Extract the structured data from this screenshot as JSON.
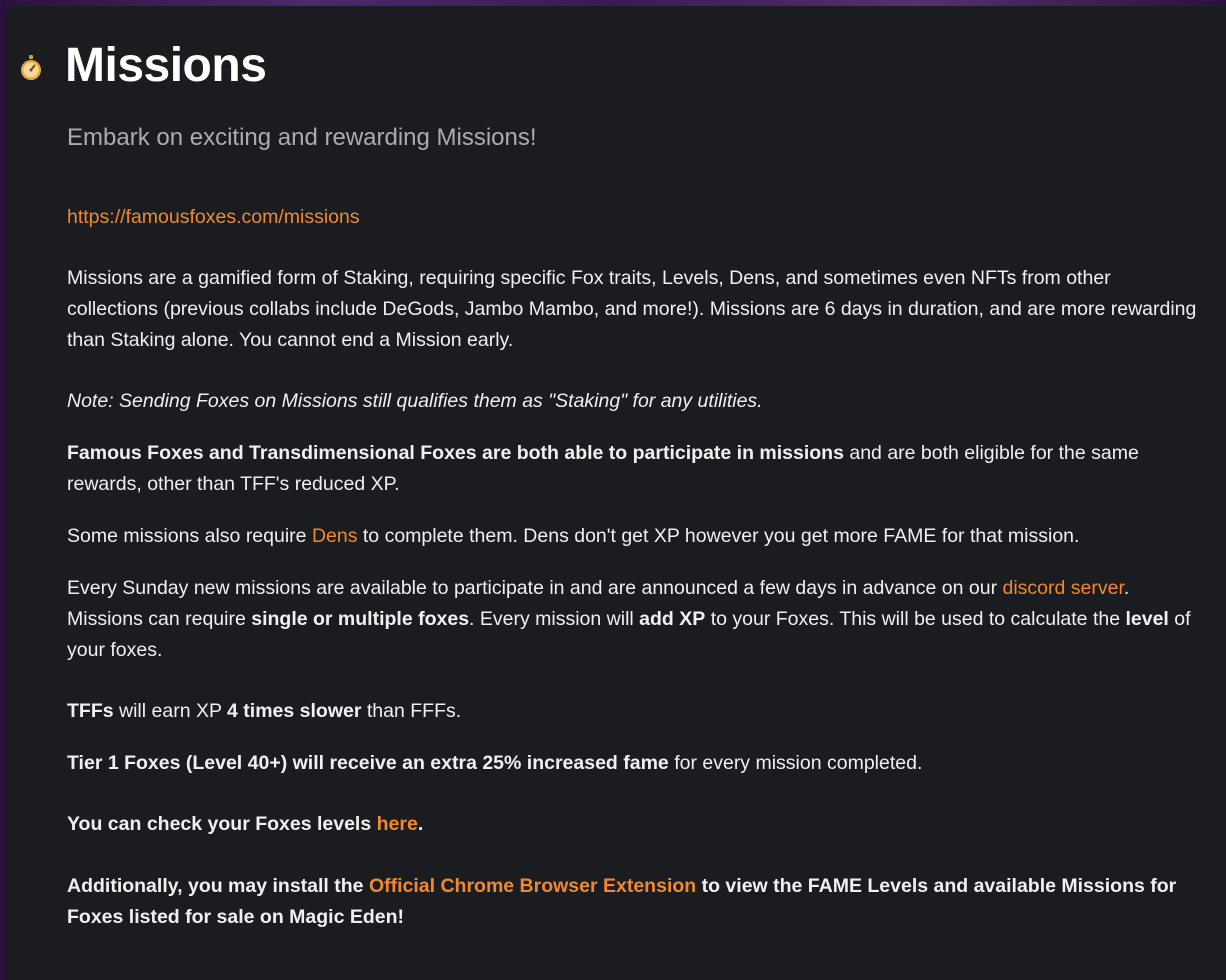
{
  "page": {
    "icon": "stopwatch-icon",
    "title": "Missions",
    "subtitle": "Embark on exciting and rewarding Missions!"
  },
  "colors": {
    "background": "#1a1c1f",
    "accent_link": "#f0892e",
    "text": "#eef0f2",
    "subtitle": "#a9acb2"
  },
  "content": {
    "url_link": "https://famousfoxes.com/missions",
    "p1": "Missions are a gamified form of Staking, requiring specific Fox traits, Levels, Dens, and sometimes even NFTs from other collections (previous collabs include DeGods, Jambo Mambo, and more!). Missions are 6 days in duration, and are more rewarding than Staking alone. You cannot end a Mission early.",
    "note": "Note: Sending Foxes on Missions still qualifies them as \"Staking\" for any utilities.",
    "p2_bold": "Famous Foxes and Transdimensional Foxes are both able to participate in missions",
    "p2_rest": " and are both eligible for the same rewards, other than TFF's reduced XP.",
    "p3_a": "Some missions also require ",
    "p3_link": "Dens",
    "p3_b": " to complete them. Dens don't get XP however you get more FAME for that mission.",
    "p4_a": "Every Sunday new missions are available to participate in and are announced a few days in advance on our ",
    "p4_link": "discord server",
    "p4_b": ". Missions can require ",
    "p4_bold1": "single or multiple foxes",
    "p4_c": ". Every mission will ",
    "p4_bold2": "add XP",
    "p4_d": " to your Foxes. This will be used to calculate the ",
    "p4_bold3": "level",
    "p4_e": " of your foxes.",
    "p5_bold1": "TFFs",
    "p5_a": " will earn XP ",
    "p5_bold2": "4 times slower",
    "p5_b": " than FFFs.",
    "p6_bold": "Tier 1 Foxes (Level 40+) will receive an extra 25% increased fame",
    "p6_rest": " for every mission completed.",
    "p7_bold": "You can check your Foxes levels ",
    "p7_link": "here",
    "p7_end": ".",
    "p8_bold_a": "Additionally, you may install the ",
    "p8_link": "Official Chrome Browser Extension",
    "p8_bold_b": " to view the FAME Levels and available Missions for Foxes listed for sale on Magic Eden!"
  }
}
